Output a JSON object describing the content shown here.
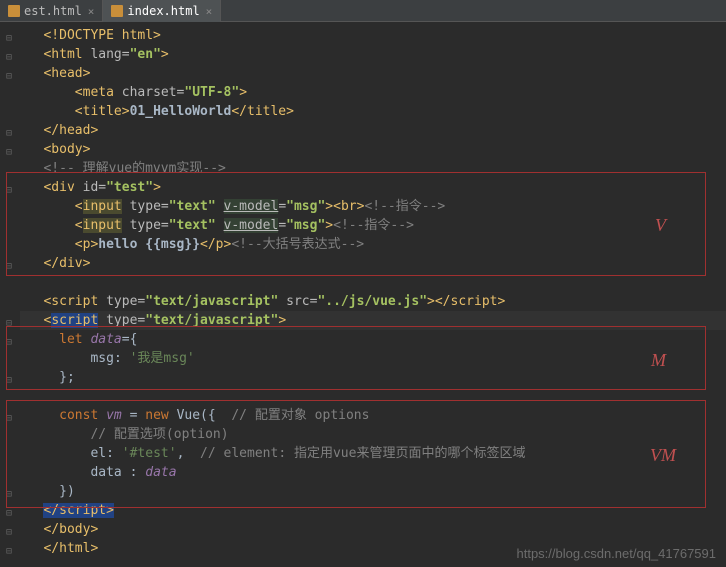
{
  "tabs": [
    {
      "label": "est.html",
      "active": false
    },
    {
      "label": "index.html",
      "active": true
    }
  ],
  "code": {
    "l1": "<!DOCTYPE html>",
    "l2_open": "<html ",
    "l2_attr": "lang=",
    "l2_val": "\"en\"",
    "l2_close": ">",
    "l3": "<head>",
    "l4_open": "<meta ",
    "l4_attr": "charset=",
    "l4_val": "\"UTF-8\"",
    "l4_close": ">",
    "l5_open": "<title>",
    "l5_text": "01_HelloWorld",
    "l5_close": "</title>",
    "l6": "</head>",
    "l7": "<body>",
    "l8": "<!-- 理解vue的mvvm实现-->",
    "l9_open": "<div ",
    "l9_attr": "id=",
    "l9_val": "\"test\"",
    "l9_close": ">",
    "l10_a": "<",
    "l10_input": "input",
    "l10_attr1": " type=",
    "l10_val1": "\"text\"",
    "l10_sp": " ",
    "l10_vmodel": "v-model",
    "l10_eq": "=",
    "l10_val2": "\"msg\"",
    "l10_c1": "><br>",
    "l10_cm": "<!--指令-->",
    "l11_a": "<",
    "l11_input": "input",
    "l11_attr1": " type=",
    "l11_val1": "\"text\"",
    "l11_sp": " ",
    "l11_vmodel": "v-model",
    "l11_eq": "=",
    "l11_val2": "\"msg\"",
    "l11_c1": ">",
    "l11_cm": "<!--指令-->",
    "l12_open": "<p>",
    "l12_text": "hello {{msg}}",
    "l12_close": "</p>",
    "l12_cm": "<!--大括号表达式-->",
    "l13": "</div>",
    "l14_open": "<script ",
    "l14_attr1": "type=",
    "l14_val1": "\"text/javascript\"",
    "l14_attr2": " src=",
    "l14_val2": "\"../js/vue.js\"",
    "l14_close": "></script>",
    "l15_a": "<",
    "l15_script": "script",
    "l15_attr": " type=",
    "l15_val": "\"text/javascript\"",
    "l15_close": ">",
    "l16_let": "let ",
    "l16_var": "data",
    "l16_eq": "={",
    "l17_key": "msg",
    "l17_colon": ": ",
    "l17_val": "'我是msg'",
    "l18": "};",
    "l19_const": "const ",
    "l19_var": "vm",
    "l19_eq": " = ",
    "l19_new": "new ",
    "l19_cls": "Vue",
    "l19_open": "({  ",
    "l19_cm": "// 配置对象 options",
    "l20_cm": "// 配置选项(option)",
    "l21_key": "el",
    "l21_colon": ": ",
    "l21_val": "'#test'",
    "l21_comma": ",  ",
    "l21_cm": "// element: 指定用vue来管理页面中的哪个标签区域",
    "l22_key": "data ",
    "l22_colon": ": ",
    "l22_var": "data",
    "l23": "})",
    "l24": "</script>",
    "l25": "</body>",
    "l26": "</html>"
  },
  "labels": {
    "v": "V",
    "m": "M",
    "vm": "VM"
  },
  "watermark": "https://blog.csdn.net/qq_41767591"
}
